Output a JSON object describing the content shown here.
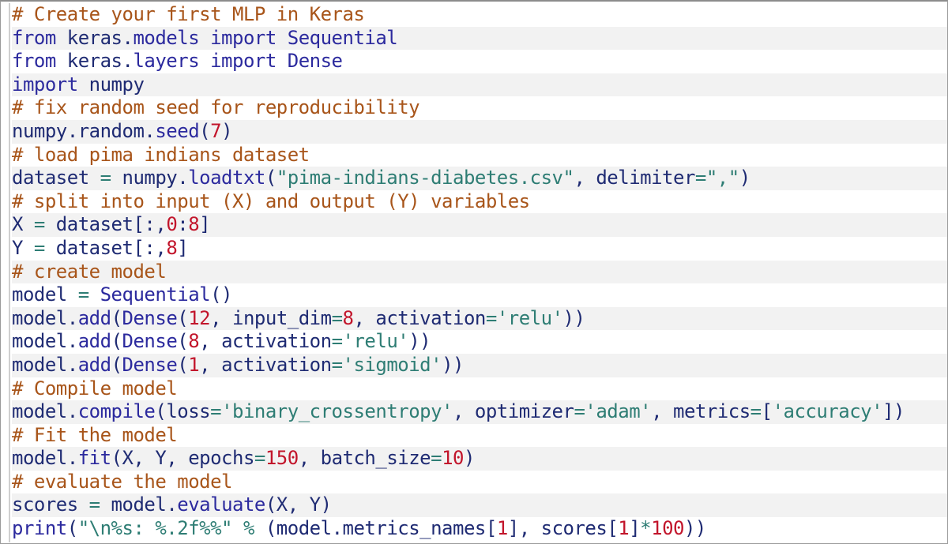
{
  "editor": {
    "language": "python",
    "colors": {
      "comment": "#a8551a",
      "keyword": "#2c2a9e",
      "name": "#1f2b73",
      "string": "#2e7d74",
      "number": "#c2152b",
      "stripe": "#f2f2f2"
    },
    "lines": [
      [
        {
          "t": "# Create your first MLP in Keras",
          "c": "comment"
        }
      ],
      [
        {
          "t": "from",
          "c": "keyword"
        },
        {
          "t": " keras",
          "c": "name"
        },
        {
          "t": ".",
          "c": "punct"
        },
        {
          "t": "models",
          "c": "func"
        },
        {
          "t": " ",
          "c": "name"
        },
        {
          "t": "import",
          "c": "keyword"
        },
        {
          "t": " Sequential",
          "c": "func"
        }
      ],
      [
        {
          "t": "from",
          "c": "keyword"
        },
        {
          "t": " keras",
          "c": "name"
        },
        {
          "t": ".",
          "c": "punct"
        },
        {
          "t": "layers",
          "c": "func"
        },
        {
          "t": " ",
          "c": "name"
        },
        {
          "t": "import",
          "c": "keyword"
        },
        {
          "t": " Dense",
          "c": "func"
        }
      ],
      [
        {
          "t": "import",
          "c": "keyword"
        },
        {
          "t": " numpy",
          "c": "name"
        }
      ],
      [
        {
          "t": "# fix random seed for reproducibility",
          "c": "comment"
        }
      ],
      [
        {
          "t": "numpy",
          "c": "name"
        },
        {
          "t": ".",
          "c": "punct"
        },
        {
          "t": "random",
          "c": "name"
        },
        {
          "t": ".",
          "c": "punct"
        },
        {
          "t": "seed",
          "c": "func"
        },
        {
          "t": "(",
          "c": "punct"
        },
        {
          "t": "7",
          "c": "number"
        },
        {
          "t": ")",
          "c": "punct"
        }
      ],
      [
        {
          "t": "# load pima indians dataset",
          "c": "comment"
        }
      ],
      [
        {
          "t": "dataset ",
          "c": "name"
        },
        {
          "t": "=",
          "c": "op"
        },
        {
          "t": " numpy",
          "c": "name"
        },
        {
          "t": ".",
          "c": "punct"
        },
        {
          "t": "loadtxt",
          "c": "func"
        },
        {
          "t": "(",
          "c": "punct"
        },
        {
          "t": "\"pima-indians-diabetes.csv\"",
          "c": "string"
        },
        {
          "t": ", delimiter",
          "c": "name"
        },
        {
          "t": "=",
          "c": "op"
        },
        {
          "t": "\",\"",
          "c": "string"
        },
        {
          "t": ")",
          "c": "punct"
        }
      ],
      [
        {
          "t": "# split into input (X) and output (Y) variables",
          "c": "comment"
        }
      ],
      [
        {
          "t": "X ",
          "c": "name"
        },
        {
          "t": "=",
          "c": "op"
        },
        {
          "t": " dataset",
          "c": "name"
        },
        {
          "t": "[:,",
          "c": "punct"
        },
        {
          "t": "0",
          "c": "number"
        },
        {
          "t": ":",
          "c": "punct"
        },
        {
          "t": "8",
          "c": "number"
        },
        {
          "t": "]",
          "c": "punct"
        }
      ],
      [
        {
          "t": "Y ",
          "c": "name"
        },
        {
          "t": "=",
          "c": "op"
        },
        {
          "t": " dataset",
          "c": "name"
        },
        {
          "t": "[:,",
          "c": "punct"
        },
        {
          "t": "8",
          "c": "number"
        },
        {
          "t": "]",
          "c": "punct"
        }
      ],
      [
        {
          "t": "# create model",
          "c": "comment"
        }
      ],
      [
        {
          "t": "model ",
          "c": "name"
        },
        {
          "t": "=",
          "c": "op"
        },
        {
          "t": " Sequential",
          "c": "func"
        },
        {
          "t": "()",
          "c": "punct"
        }
      ],
      [
        {
          "t": "model",
          "c": "name"
        },
        {
          "t": ".",
          "c": "punct"
        },
        {
          "t": "add",
          "c": "func"
        },
        {
          "t": "(",
          "c": "punct"
        },
        {
          "t": "Dense",
          "c": "func"
        },
        {
          "t": "(",
          "c": "punct"
        },
        {
          "t": "12",
          "c": "number"
        },
        {
          "t": ", input_dim",
          "c": "name"
        },
        {
          "t": "=",
          "c": "op"
        },
        {
          "t": "8",
          "c": "number"
        },
        {
          "t": ", activation",
          "c": "name"
        },
        {
          "t": "=",
          "c": "op"
        },
        {
          "t": "'relu'",
          "c": "string"
        },
        {
          "t": "))",
          "c": "punct"
        }
      ],
      [
        {
          "t": "model",
          "c": "name"
        },
        {
          "t": ".",
          "c": "punct"
        },
        {
          "t": "add",
          "c": "func"
        },
        {
          "t": "(",
          "c": "punct"
        },
        {
          "t": "Dense",
          "c": "func"
        },
        {
          "t": "(",
          "c": "punct"
        },
        {
          "t": "8",
          "c": "number"
        },
        {
          "t": ", activation",
          "c": "name"
        },
        {
          "t": "=",
          "c": "op"
        },
        {
          "t": "'relu'",
          "c": "string"
        },
        {
          "t": "))",
          "c": "punct"
        }
      ],
      [
        {
          "t": "model",
          "c": "name"
        },
        {
          "t": ".",
          "c": "punct"
        },
        {
          "t": "add",
          "c": "func"
        },
        {
          "t": "(",
          "c": "punct"
        },
        {
          "t": "Dense",
          "c": "func"
        },
        {
          "t": "(",
          "c": "punct"
        },
        {
          "t": "1",
          "c": "number"
        },
        {
          "t": ", activation",
          "c": "name"
        },
        {
          "t": "=",
          "c": "op"
        },
        {
          "t": "'sigmoid'",
          "c": "string"
        },
        {
          "t": "))",
          "c": "punct"
        }
      ],
      [
        {
          "t": "# Compile model",
          "c": "comment"
        }
      ],
      [
        {
          "t": "model",
          "c": "name"
        },
        {
          "t": ".",
          "c": "punct"
        },
        {
          "t": "compile",
          "c": "func"
        },
        {
          "t": "(",
          "c": "punct"
        },
        {
          "t": "loss",
          "c": "name"
        },
        {
          "t": "=",
          "c": "op"
        },
        {
          "t": "'binary_crossentropy'",
          "c": "string"
        },
        {
          "t": ", optimizer",
          "c": "name"
        },
        {
          "t": "=",
          "c": "op"
        },
        {
          "t": "'adam'",
          "c": "string"
        },
        {
          "t": ", metrics",
          "c": "name"
        },
        {
          "t": "=",
          "c": "op"
        },
        {
          "t": "[",
          "c": "punct"
        },
        {
          "t": "'accuracy'",
          "c": "string"
        },
        {
          "t": "])",
          "c": "punct"
        }
      ],
      [
        {
          "t": "# Fit the model",
          "c": "comment"
        }
      ],
      [
        {
          "t": "model",
          "c": "name"
        },
        {
          "t": ".",
          "c": "punct"
        },
        {
          "t": "fit",
          "c": "func"
        },
        {
          "t": "(X, Y, epochs",
          "c": "name"
        },
        {
          "t": "=",
          "c": "op"
        },
        {
          "t": "150",
          "c": "number"
        },
        {
          "t": ", batch_size",
          "c": "name"
        },
        {
          "t": "=",
          "c": "op"
        },
        {
          "t": "10",
          "c": "number"
        },
        {
          "t": ")",
          "c": "punct"
        }
      ],
      [
        {
          "t": "# evaluate the model",
          "c": "comment"
        }
      ],
      [
        {
          "t": "scores ",
          "c": "name"
        },
        {
          "t": "=",
          "c": "op"
        },
        {
          "t": " model",
          "c": "name"
        },
        {
          "t": ".",
          "c": "punct"
        },
        {
          "t": "evaluate",
          "c": "func"
        },
        {
          "t": "(X, Y)",
          "c": "name"
        }
      ],
      [
        {
          "t": "print",
          "c": "func"
        },
        {
          "t": "(",
          "c": "punct"
        },
        {
          "t": "\"\\n%s: %.2f%%\"",
          "c": "string"
        },
        {
          "t": " ",
          "c": "name"
        },
        {
          "t": "%",
          "c": "op"
        },
        {
          "t": " (model",
          "c": "name"
        },
        {
          "t": ".",
          "c": "punct"
        },
        {
          "t": "metrics_names",
          "c": "name"
        },
        {
          "t": "[",
          "c": "punct"
        },
        {
          "t": "1",
          "c": "number"
        },
        {
          "t": "], scores",
          "c": "name"
        },
        {
          "t": "[",
          "c": "punct"
        },
        {
          "t": "1",
          "c": "number"
        },
        {
          "t": "]",
          "c": "punct"
        },
        {
          "t": "*",
          "c": "op"
        },
        {
          "t": "100",
          "c": "number"
        },
        {
          "t": "))",
          "c": "punct"
        }
      ]
    ]
  }
}
